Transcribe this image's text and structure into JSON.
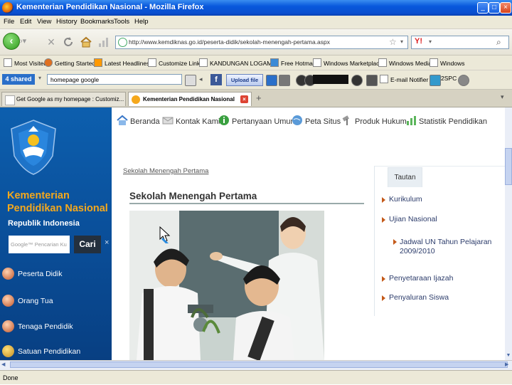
{
  "window": {
    "title": "Kementerian Pendidikan Nasional - Mozilla Firefox"
  },
  "menu": [
    "File",
    "Edit",
    "View",
    "History",
    "Bookmarks",
    "Tools",
    "Help"
  ],
  "nav": {
    "url": "http://www.kemdiknas.go.id/peserta-didik/sekolah-menengah-pertama.aspx"
  },
  "bookmarks": [
    "Most Visited",
    "Getting Started",
    "Latest Headlines",
    "Customize Links",
    "KANDUNGAN LOGAM ...",
    "Free Hotmail",
    "Windows Marketplace",
    "Windows Media",
    "Windows"
  ],
  "toolbar": {
    "shared": "4 shared",
    "homepage": "homepage google",
    "facebook": "f",
    "upload": "Upload file",
    "email_notifier": "E-mail Notifier",
    "cspc": "2SPC"
  },
  "tabs": [
    {
      "label": "Get Google as my homepage : Customiz..."
    },
    {
      "label": "Kementerian Pendidikan Nasional"
    }
  ],
  "sidebar": {
    "ministry_line1": "Kementerian",
    "ministry_line2": "Pendidikan Nasional",
    "republic": "Republik Indonesia",
    "search_placeholder": "Google™ Pencarian Ku",
    "search_button": "Cari",
    "close": "×",
    "items": [
      "Peserta Didik",
      "Orang Tua",
      "Tenaga Pendidik",
      "Satuan Pendidikan"
    ]
  },
  "topnav": [
    "Beranda",
    "Kontak Kami",
    "Pertanyaan Umum",
    "Peta Situs",
    "Produk Hukum",
    "Statistik Pendidikan"
  ],
  "content": {
    "breadcrumb": "Sekolah Menengah Pertama",
    "title": "Sekolah Menengah Pertama"
  },
  "right_panel": {
    "tab": "Tautan",
    "links": [
      "Kurikulum",
      "Ujian Nasional",
      "Jadwal UN Tahun Pelajaran 2009/2010",
      "Penyetaraan Ijazah",
      "Penyaluran Siswa"
    ]
  },
  "status": "Done"
}
